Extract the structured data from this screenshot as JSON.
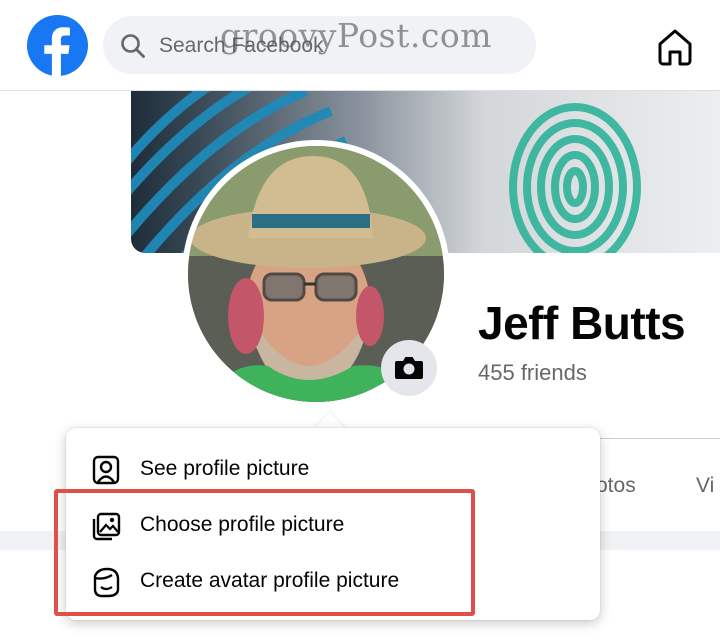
{
  "topbar": {
    "logo_icon": "facebook-logo-icon",
    "search_placeholder": "Search Facebook",
    "search_icon": "search-icon",
    "home_icon": "home-icon",
    "watermark": "groovyPost.com"
  },
  "profile": {
    "name": "Jeff Butts",
    "friends": "455 friends",
    "camera_icon": "camera-icon",
    "tabs": [
      "otos",
      "Vi"
    ]
  },
  "menu": {
    "items": [
      {
        "label": "See profile picture",
        "icon": "person-portrait-icon"
      },
      {
        "label": "Choose profile picture",
        "icon": "image-gallery-icon"
      },
      {
        "label": "Create avatar profile picture",
        "icon": "avatar-face-icon"
      }
    ]
  },
  "colors": {
    "facebook_blue": "#1877f2",
    "highlight_red": "#e04f4a",
    "background": "#f0f2f5",
    "text_primary": "#050505",
    "text_secondary": "#65676b"
  }
}
